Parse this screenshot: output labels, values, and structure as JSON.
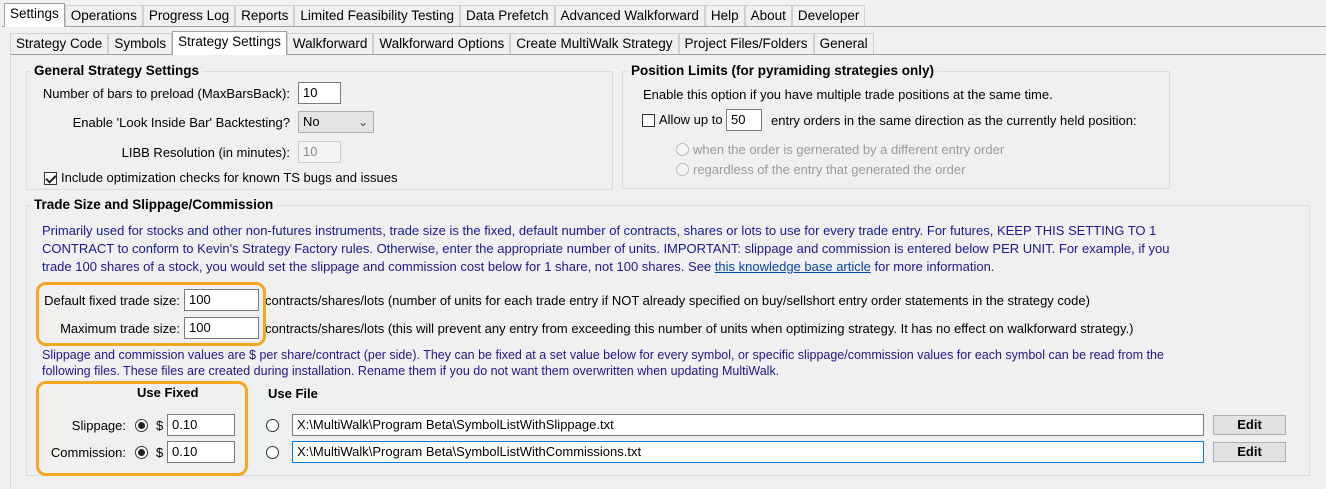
{
  "top_tabs": [
    "Settings",
    "Operations",
    "Progress Log",
    "Reports",
    "Limited Feasibility Testing",
    "Data Prefetch",
    "Advanced Walkforward",
    "Help",
    "About",
    "Developer"
  ],
  "sub_tabs": [
    "Strategy Code",
    "Symbols",
    "Strategy Settings",
    "Walkforward",
    "Walkforward Options",
    "Create MultiWalk Strategy",
    "Project Files/Folders",
    "General"
  ],
  "general": {
    "title": "General Strategy Settings",
    "maxbars_label": "Number of bars to preload (MaxBarsBack):",
    "maxbars_value": "10",
    "libb_label": "Enable 'Look Inside Bar' Backtesting?",
    "libb_value": "No",
    "libb_res_label": "LIBB Resolution (in minutes):",
    "libb_res_value": "10",
    "optcheck_label": "Include optimization checks for known TS bugs and issues"
  },
  "position": {
    "title": "Position Limits (for pyramiding strategies only)",
    "desc": "Enable this option if you have multiple trade positions at the same time.",
    "allow_label": "Allow up to",
    "allow_value": "50",
    "allow_suffix": "entry orders in the same direction as the currently held position:",
    "radio1": "when the order is gernerated by a different entry order",
    "radio2": "regardless of the entry that generated the order"
  },
  "trade": {
    "title": "Trade Size and Slippage/Commission",
    "desc_line1": "Primarily used for stocks and other non-futures instruments, trade size is the fixed, default number of contracts, shares or lots to use for every trade entry. For futures, KEEP THIS SETTING TO 1",
    "desc_line2": "CONTRACT to conform to Kevin's Strategy Factory rules. Otherwise, enter the appropriate number of units. IMPORTANT: slippage and commission is entered below PER UNIT. For example, if you",
    "desc_line3_pre": "trade 100 shares of a stock, you would set the slippage and commission cost below for 1 share, not 100 shares. See ",
    "desc_link": "this knowledge base article",
    "desc_line3_post": " for more information.",
    "default_label": "Default fixed trade size:",
    "default_value": "100",
    "default_suffix": "contracts/shares/lots (number of units for each trade entry if NOT already specified on buy/sellshort entry order statements in the strategy code)",
    "max_label": "Maximum trade size:",
    "max_value": "100",
    "max_suffix": "contracts/shares/lots (this will prevent any entry from exceeding this number of units when optimizing strategy.  It has no effect on walkforward strategy.)",
    "slip_desc_line1": "Slippage and commission values are $ per share/contract (per side).  They can be fixed at a set value below for every symbol, or specific slippage/commission values for each symbol can be read from the",
    "slip_desc_line2": "following files.  These files are created during installation.  Rename them if you do not want them overwritten when updating MultiWalk.",
    "use_fixed": "Use Fixed",
    "use_file": "Use File",
    "slippage_label": "Slippage:",
    "commission_label": "Commission:",
    "dollar": "$",
    "slippage_value": "0.10",
    "commission_value": "0.10",
    "slippage_file": "X:\\MultiWalk\\Program Beta\\SymbolListWithSlippage.txt",
    "commission_file": "X:\\MultiWalk\\Program Beta\\SymbolListWithCommissions.txt",
    "edit_label": "Edit"
  },
  "colors": {
    "highlight": "#f5a623",
    "blue_text": "#1a1a8c",
    "link": "#0645ad"
  }
}
